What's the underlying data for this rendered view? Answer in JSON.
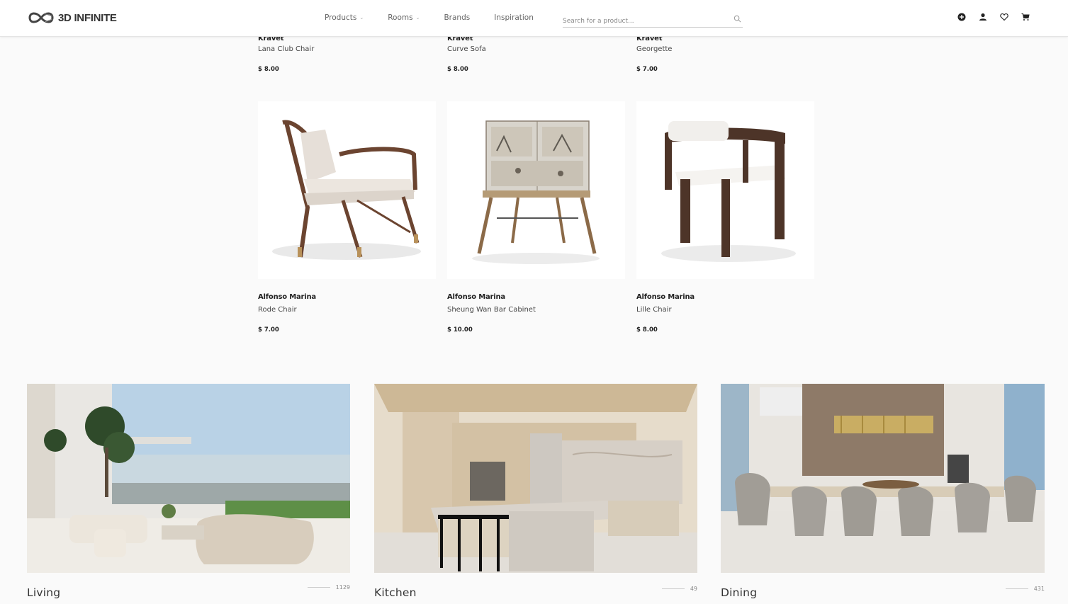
{
  "header": {
    "logo_text": "3D INFINITE",
    "nav": [
      {
        "label": "Products",
        "dropdown": true
      },
      {
        "label": "Rooms",
        "dropdown": true
      },
      {
        "label": "Brands",
        "dropdown": false
      },
      {
        "label": "Inspiration",
        "dropdown": false
      }
    ],
    "search_placeholder": "Search for a product...",
    "icons": [
      "add-icon",
      "user-icon",
      "heart-icon",
      "cart-icon"
    ]
  },
  "products_top": [
    {
      "brand": "Kravet",
      "name": "Lana Club Chair",
      "price": "$ 8.00"
    },
    {
      "brand": "Kravet",
      "name": "Curve Sofa",
      "price": "$ 8.00"
    },
    {
      "brand": "Kravet",
      "name": "Georgette",
      "price": "$ 7.00"
    }
  ],
  "products": [
    {
      "brand": "Alfonso Marina",
      "name": "Rode Chair",
      "price": "$ 7.00"
    },
    {
      "brand": "Alfonso Marina",
      "name": "Sheung Wan Bar Cabinet",
      "price": "$ 10.00"
    },
    {
      "brand": "Alfonso Marina",
      "name": "Lille Chair",
      "price": "$ 8.00"
    }
  ],
  "rooms": [
    {
      "title": "Living",
      "count": "1129"
    },
    {
      "title": "Kitchen",
      "count": "49"
    },
    {
      "title": "Dining",
      "count": "431"
    }
  ]
}
